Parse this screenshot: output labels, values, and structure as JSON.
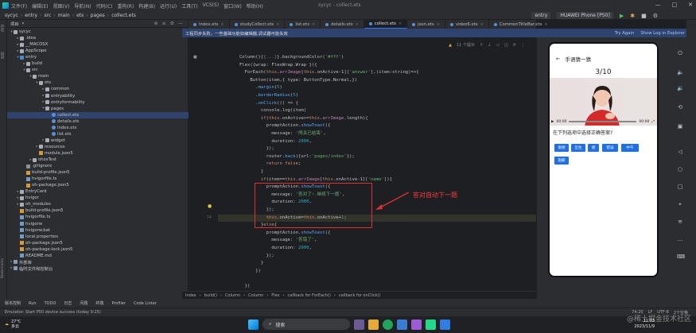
{
  "titlebar": {
    "menus": [
      "文件(F)",
      "编辑(E)",
      "视图(V)",
      "导航(N)",
      "代码(C)",
      "重构(R)",
      "构建(B)",
      "运行(U)",
      "工具(T)",
      "VCS(S)",
      "窗口(W)",
      "帮助(H)"
    ],
    "window_title": "sycyc - collect.ets"
  },
  "navbar": {
    "crumbs": [
      "sycyc",
      "entry",
      "src",
      "main",
      "ets",
      "pages",
      "collect.ets"
    ],
    "run_config": "entry",
    "device": "HUAWEI Phone [P50]"
  },
  "left_strip": [
    "项目",
    "结构",
    "Bookmarks"
  ],
  "project": {
    "title": "项目",
    "tree": [
      {
        "label": "sycyc",
        "depth": 0,
        "icon": "folder",
        "arrow": "▾"
      },
      {
        "label": ".idea",
        "depth": 1,
        "icon": "folder",
        "arrow": "▸"
      },
      {
        "label": "__MACOSX",
        "depth": 1,
        "icon": "folder",
        "arrow": "▸"
      },
      {
        "label": "AppScope",
        "depth": 1,
        "icon": "folder",
        "arrow": "▸"
      },
      {
        "label": "entry",
        "depth": 1,
        "icon": "src",
        "arrow": "▾"
      },
      {
        "label": "build",
        "depth": 2,
        "icon": "folder",
        "arrow": "▸"
      },
      {
        "label": "src",
        "depth": 2,
        "icon": "folder",
        "arrow": "▾"
      },
      {
        "label": "main",
        "depth": 3,
        "icon": "folder",
        "arrow": "▾"
      },
      {
        "label": "ets",
        "depth": 4,
        "icon": "folder",
        "arrow": "▾"
      },
      {
        "label": "common",
        "depth": 5,
        "icon": "folder",
        "arrow": "▸"
      },
      {
        "label": "entryability",
        "depth": 5,
        "icon": "folder",
        "arrow": "▸"
      },
      {
        "label": "entryformability",
        "depth": 5,
        "icon": "folder",
        "arrow": "▸"
      },
      {
        "label": "pages",
        "depth": 5,
        "icon": "folder",
        "arrow": "▾"
      },
      {
        "label": "collect.ets",
        "depth": 6,
        "icon": "ets",
        "arrow": "",
        "selected": true
      },
      {
        "label": "details.ets",
        "depth": 6,
        "icon": "ets",
        "arrow": ""
      },
      {
        "label": "Index.ets",
        "depth": 6,
        "icon": "ets",
        "arrow": ""
      },
      {
        "label": "list.ets",
        "depth": 6,
        "icon": "ets",
        "arrow": ""
      },
      {
        "label": "widget",
        "depth": 5,
        "icon": "folder",
        "arrow": "▸"
      },
      {
        "label": "resources",
        "depth": 4,
        "icon": "folder",
        "arrow": "▸"
      },
      {
        "label": "module.json5",
        "depth": 4,
        "icon": "json",
        "arrow": ""
      },
      {
        "label": "ohosTest",
        "depth": 3,
        "icon": "folder",
        "arrow": "▸"
      },
      {
        "label": ".gitignore",
        "depth": 2,
        "icon": "ignore",
        "arrow": ""
      },
      {
        "label": "build-profile.json5",
        "depth": 2,
        "icon": "json",
        "arrow": ""
      },
      {
        "label": "hvigorfile.ts",
        "depth": 2,
        "icon": "file",
        "arrow": ""
      },
      {
        "label": "oh-package.json5",
        "depth": 2,
        "icon": "json",
        "arrow": ""
      },
      {
        "label": "EntryCard",
        "depth": 1,
        "icon": "folder",
        "arrow": "▸"
      },
      {
        "label": "hvigor",
        "depth": 1,
        "icon": "folder",
        "arrow": "▸"
      },
      {
        "label": "oh_modules",
        "depth": 1,
        "icon": "folder",
        "arrow": "▸"
      },
      {
        "label": "build-profile.json5",
        "depth": 1,
        "icon": "json",
        "arrow": ""
      },
      {
        "label": "hvigorfile.ts",
        "depth": 1,
        "icon": "file",
        "arrow": ""
      },
      {
        "label": "hvigorw",
        "depth": 1,
        "icon": "file",
        "arrow": ""
      },
      {
        "label": "hvigorw.bat",
        "depth": 1,
        "icon": "file",
        "arrow": ""
      },
      {
        "label": "local.properties",
        "depth": 1,
        "icon": "file",
        "arrow": ""
      },
      {
        "label": "oh-package.json5",
        "depth": 1,
        "icon": "json",
        "arrow": ""
      },
      {
        "label": "oh-package-lock.json5",
        "depth": 1,
        "icon": "json",
        "arrow": ""
      },
      {
        "label": "README.md",
        "depth": 1,
        "icon": "file",
        "arrow": ""
      },
      {
        "label": "外部库",
        "depth": 0,
        "icon": "lib",
        "arrow": "▸"
      },
      {
        "label": "临时文件和控制台",
        "depth": 0,
        "icon": "lib",
        "arrow": "▸"
      }
    ]
  },
  "tabs": [
    {
      "label": "Index.ets"
    },
    {
      "label": "studyCollect.ets"
    },
    {
      "label": "list.ets"
    },
    {
      "label": "details.ets"
    },
    {
      "label": "collect.ets",
      "active": true
    },
    {
      "label": "json.ets"
    },
    {
      "label": "video6.ets"
    },
    {
      "label": "CommonTitleBar.ets"
    }
  ],
  "notice": {
    "text": "工程同步失败，一些基础功能如编辑器,调试器可能失效",
    "try_again": "Try Again",
    "show_log": "Show Log in Explorer"
  },
  "editor_toolbar": {
    "warnings": "11 个提示"
  },
  "code": {
    "line_numbers": [
      "",
      "",
      "",
      "",
      "",
      "",
      "",
      "",
      "",
      "",
      "",
      "",
      "",
      "",
      "",
      "",
      "",
      "",
      "",
      "",
      "",
      "74",
      "",
      "",
      "",
      "",
      "",
      "",
      "",
      "",
      ""
    ],
    "lines": [
      [
        [
          "t",
          "        Column(){"
        ],
        [
          "c",
          "{...}"
        ],
        [
          "t",
          "}.backgroundColor("
        ],
        [
          "s",
          "'#fff'"
        ],
        [
          "t",
          ")"
        ]
      ],
      [
        [
          "t",
          "        Flex({wrap: FlexWrap.Wrap }){"
        ]
      ],
      [
        [
          "t",
          "          ForEach("
        ],
        [
          "k",
          "this"
        ],
        [
          "t",
          "."
        ],
        [
          "p",
          "arrImage"
        ],
        [
          "t",
          "["
        ],
        [
          "k",
          "this"
        ],
        [
          "t",
          ".onActive-1]["
        ],
        [
          "s",
          "'answer'"
        ],
        [
          "t",
          "],(item:string)=>{"
        ]
      ],
      [
        [
          "t",
          "            Button(item,{ type: ButtonType.Normal,})"
        ]
      ],
      [
        [
          "t",
          "              ."
        ],
        [
          "f",
          "margin"
        ],
        [
          "t",
          "("
        ],
        [
          "n",
          "5"
        ],
        [
          "t",
          ")"
        ]
      ],
      [
        [
          "t",
          "              ."
        ],
        [
          "f",
          "borderRadius"
        ],
        [
          "t",
          "("
        ],
        [
          "n",
          "5"
        ],
        [
          "t",
          ")"
        ]
      ],
      [
        [
          "t",
          "              ."
        ],
        [
          "f",
          "onClick"
        ],
        [
          "t",
          "(() => {"
        ]
      ],
      [
        [
          "t",
          "                console.log(item)"
        ]
      ],
      [
        [
          "t",
          "                "
        ],
        [
          "k",
          "if"
        ],
        [
          "t",
          "("
        ],
        [
          "k",
          "this"
        ],
        [
          "t",
          ".onActive>="
        ],
        [
          "k",
          "this"
        ],
        [
          "t",
          "."
        ],
        [
          "p",
          "arrImage"
        ],
        [
          "t",
          ".length){"
        ]
      ],
      [
        [
          "t",
          "                  promptAction."
        ],
        [
          "f",
          "showToast"
        ],
        [
          "t",
          "({"
        ]
      ],
      [
        [
          "t",
          "                    message: "
        ],
        [
          "s",
          "'闯关已结束'"
        ],
        [
          "t",
          ","
        ]
      ],
      [
        [
          "t",
          "                    duration: "
        ],
        [
          "n",
          "2000"
        ],
        [
          "t",
          ","
        ]
      ],
      [
        [
          "t",
          "                  });"
        ]
      ],
      [
        [
          "t",
          "                  router."
        ],
        [
          "f",
          "back"
        ],
        [
          "t",
          "({url:"
        ],
        [
          "s",
          "'pages/index'"
        ],
        [
          "t",
          "});"
        ]
      ],
      [
        [
          "t",
          "                  "
        ],
        [
          "k",
          "return false"
        ],
        [
          "t",
          ";"
        ]
      ],
      [
        [
          "t",
          "                }"
        ]
      ],
      [
        [
          "t",
          "                "
        ],
        [
          "k",
          "if"
        ],
        [
          "t",
          "(item=="
        ],
        [
          "k",
          "this"
        ],
        [
          "t",
          "."
        ],
        [
          "p",
          "arrImage"
        ],
        [
          "t",
          "["
        ],
        [
          "k",
          "this"
        ],
        [
          "t",
          ".onActive-1]["
        ],
        [
          "s",
          "'name'"
        ],
        [
          "t",
          "]){"
        ]
      ],
      [
        [
          "t",
          "                  promptAction."
        ],
        [
          "f",
          "showToast"
        ],
        [
          "t",
          "({"
        ]
      ],
      [
        [
          "t",
          "                    message: "
        ],
        [
          "s",
          "'答对了~ 继续下一题'"
        ],
        [
          "t",
          ","
        ]
      ],
      [
        [
          "t",
          "                    duration: "
        ],
        [
          "n",
          "2000"
        ],
        [
          "t",
          ","
        ]
      ],
      [
        [
          "t",
          "                  });"
        ]
      ],
      [
        [
          "k",
          "                  this"
        ],
        [
          "t",
          ".onActive="
        ],
        [
          "k",
          "this"
        ],
        [
          "t",
          ".onActive+"
        ],
        [
          "n",
          "1"
        ],
        [
          "t",
          ";"
        ]
      ],
      [
        [
          "t",
          "                }"
        ],
        [
          "k",
          "else"
        ],
        [
          "t",
          "{"
        ]
      ],
      [
        [
          "t",
          "                  promptAction."
        ],
        [
          "f",
          "showToast"
        ],
        [
          "t",
          "({"
        ]
      ],
      [
        [
          "t",
          "                    message: "
        ],
        [
          "s",
          "'答错了'"
        ],
        [
          "t",
          ","
        ]
      ],
      [
        [
          "t",
          "                    duration: "
        ],
        [
          "n",
          "2000"
        ],
        [
          "t",
          ","
        ]
      ],
      [
        [
          "t",
          "                  });"
        ]
      ],
      [
        [
          "t",
          "                }"
        ]
      ],
      [
        [
          "t",
          "              })"
        ]
      ],
      [
        [
          "t",
          ""
        ]
      ],
      [
        [
          "t",
          "          })"
        ]
      ]
    ]
  },
  "annotation": "答对自动下一题",
  "phone": {
    "header_title": "手语猜一猜",
    "counter": "3/10",
    "time_start": "00:00",
    "time_end": "00:00",
    "question": "在下列选项中选择正确答案?",
    "options": [
      "谢谢",
      "出生",
      "想",
      "错误",
      "中午",
      "抱歉"
    ]
  },
  "bottom_crumbs": [
    "Index",
    "build()",
    "Column",
    "Column",
    "Flex",
    "callback for ForEach()",
    "callback for onClick()"
  ],
  "tool_tabs": [
    "版本控制",
    "Run",
    "TODO",
    "日志",
    "问题",
    "终端",
    "Profiler",
    "Code Linter"
  ],
  "status": {
    "text": "Emulator: Start P50 device success (today 9:25)",
    "right": [
      "74:20",
      "LF",
      "UTF-8",
      "2个空格"
    ]
  },
  "taskbar": {
    "temp": "27°C",
    "weather": "多云",
    "search": "搜索",
    "time": "11:03",
    "date": "2023/11/9"
  },
  "watermark": "@稀土掘金技术社区",
  "colors": {
    "accent": "#3574f0",
    "button": "#1e6fe8",
    "annotation": "#e03030"
  }
}
